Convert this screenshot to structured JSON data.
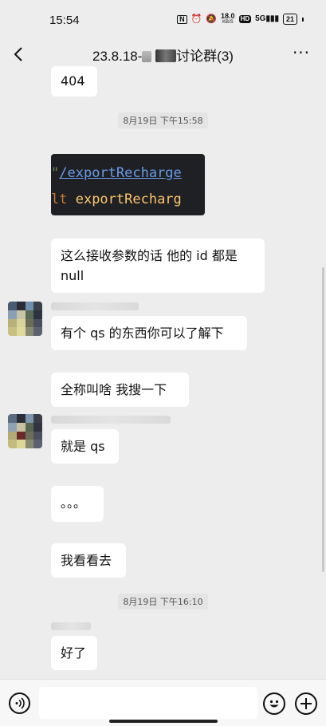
{
  "status_bar": {
    "time": "15:54",
    "nfc": "N",
    "net_speed_value": "18.0",
    "net_speed_unit": "KB/S",
    "hd": "HD",
    "signal": "5G",
    "battery": "21"
  },
  "header": {
    "title_prefix": "23.8.18-",
    "title_suffix": "讨论群(3)",
    "more": "···"
  },
  "messages": [
    {
      "text": "404"
    },
    {
      "text": "这么接收参数的话  他的 id 都是 null"
    },
    {
      "text": "有个 qs 的东西你可以了解下"
    },
    {
      "text": "全称叫啥  我搜一下"
    },
    {
      "text": "就是 qs"
    },
    {
      "text": "。。。"
    },
    {
      "text": "我看看去"
    },
    {
      "text": "好了"
    }
  ],
  "timestamps": [
    "8月19日 下午15:58",
    "8月19日 下午16:10"
  ],
  "code_image": {
    "line1_quote": "\"",
    "line1_link": "/exportRecharge",
    "line2_keyword": "lt ",
    "line2_fn": "exportRecharg"
  },
  "colors": {
    "background": "#ededed",
    "bubble": "#ffffff",
    "code_bg": "#1e2023"
  },
  "icons": [
    "back-icon",
    "more-icon",
    "voice-icon",
    "emoji-icon",
    "plus-icon",
    "alarm-icon",
    "mute-icon",
    "signal-icon",
    "battery-icon"
  ]
}
